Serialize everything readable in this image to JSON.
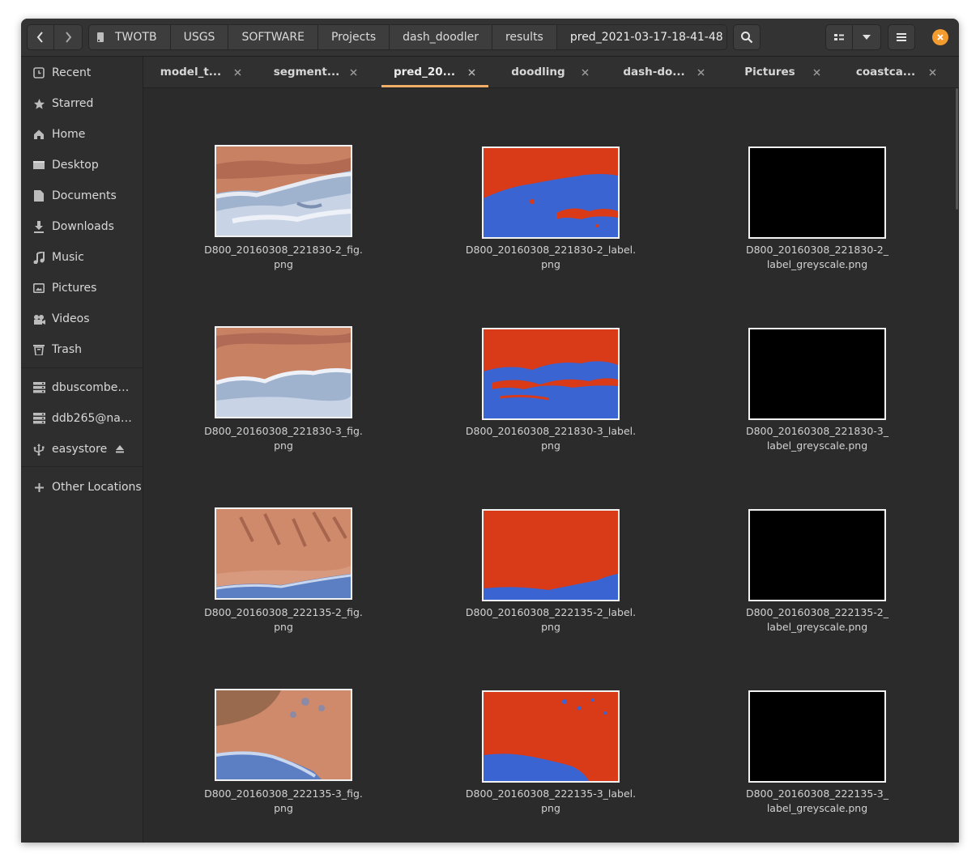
{
  "window": {
    "path": [
      "TWOTB",
      "USGS",
      "SOFTWARE",
      "Projects",
      "dash_doodler",
      "results",
      "pred_2021-03-17-18-41-48"
    ],
    "icons": {
      "back": "go-back-icon",
      "forward": "go-forward-icon",
      "search": "search-icon",
      "view": "grid-view-icon",
      "view_menu": "chevron-down-icon",
      "menu": "hamburger-menu-icon",
      "close": "close-icon"
    },
    "accent": "#f0ae69",
    "close_color": "#f29b2f"
  },
  "sidebar": {
    "items": [
      {
        "label": "Recent",
        "icon": "clock-icon"
      },
      {
        "label": "Starred",
        "icon": "star-icon"
      },
      {
        "label": "Home",
        "icon": "home-icon"
      },
      {
        "label": "Desktop",
        "icon": "desktop-icon"
      },
      {
        "label": "Documents",
        "icon": "document-icon"
      },
      {
        "label": "Downloads",
        "icon": "download-icon"
      },
      {
        "label": "Music",
        "icon": "music-icon"
      },
      {
        "label": "Pictures",
        "icon": "pictures-icon"
      },
      {
        "label": "Videos",
        "icon": "videos-icon"
      },
      {
        "label": "Trash",
        "icon": "trash-icon"
      }
    ],
    "mounts": [
      {
        "label": "dbuscombe@...",
        "icon": "network-drive-icon"
      },
      {
        "label": "ddb265@nau....",
        "icon": "network-drive-icon"
      },
      {
        "label": "easystore",
        "icon": "usb-icon"
      }
    ],
    "other": {
      "label": "Other Locations",
      "icon": "plus-icon"
    }
  },
  "tabs": [
    {
      "label": "model_t..."
    },
    {
      "label": "segment..."
    },
    {
      "label": "pred_20..."
    },
    {
      "label": "doodling"
    },
    {
      "label": "dash-do..."
    },
    {
      "label": "Pictures"
    },
    {
      "label": "coastca..."
    }
  ],
  "active_tab": 2,
  "files": [
    {
      "line1": "D800_20160308_221830-2_fig.",
      "line2": "png",
      "kind": "fig1"
    },
    {
      "line1": "D800_20160308_221830-2_label.",
      "line2": "png",
      "kind": "label1"
    },
    {
      "line1": "D800_20160308_221830-2_",
      "line2": "label_greyscale.png",
      "kind": "grey"
    },
    {
      "line1": "D800_20160308_221830-3_fig.",
      "line2": "png",
      "kind": "fig2"
    },
    {
      "line1": "D800_20160308_221830-3_label.",
      "line2": "png",
      "kind": "label2"
    },
    {
      "line1": "D800_20160308_221830-3_",
      "line2": "label_greyscale.png",
      "kind": "grey"
    },
    {
      "line1": "D800_20160308_222135-2_fig.",
      "line2": "png",
      "kind": "fig3"
    },
    {
      "line1": "D800_20160308_222135-2_label.",
      "line2": "png",
      "kind": "label3"
    },
    {
      "line1": "D800_20160308_222135-2_",
      "line2": "label_greyscale.png",
      "kind": "grey"
    },
    {
      "line1": "D800_20160308_222135-3_fig.",
      "line2": "png",
      "kind": "fig4"
    },
    {
      "line1": "D800_20160308_222135-3_label.",
      "line2": "png",
      "kind": "label4"
    },
    {
      "line1": "D800_20160308_222135-3_",
      "line2": "label_greyscale.png",
      "kind": "grey"
    }
  ]
}
